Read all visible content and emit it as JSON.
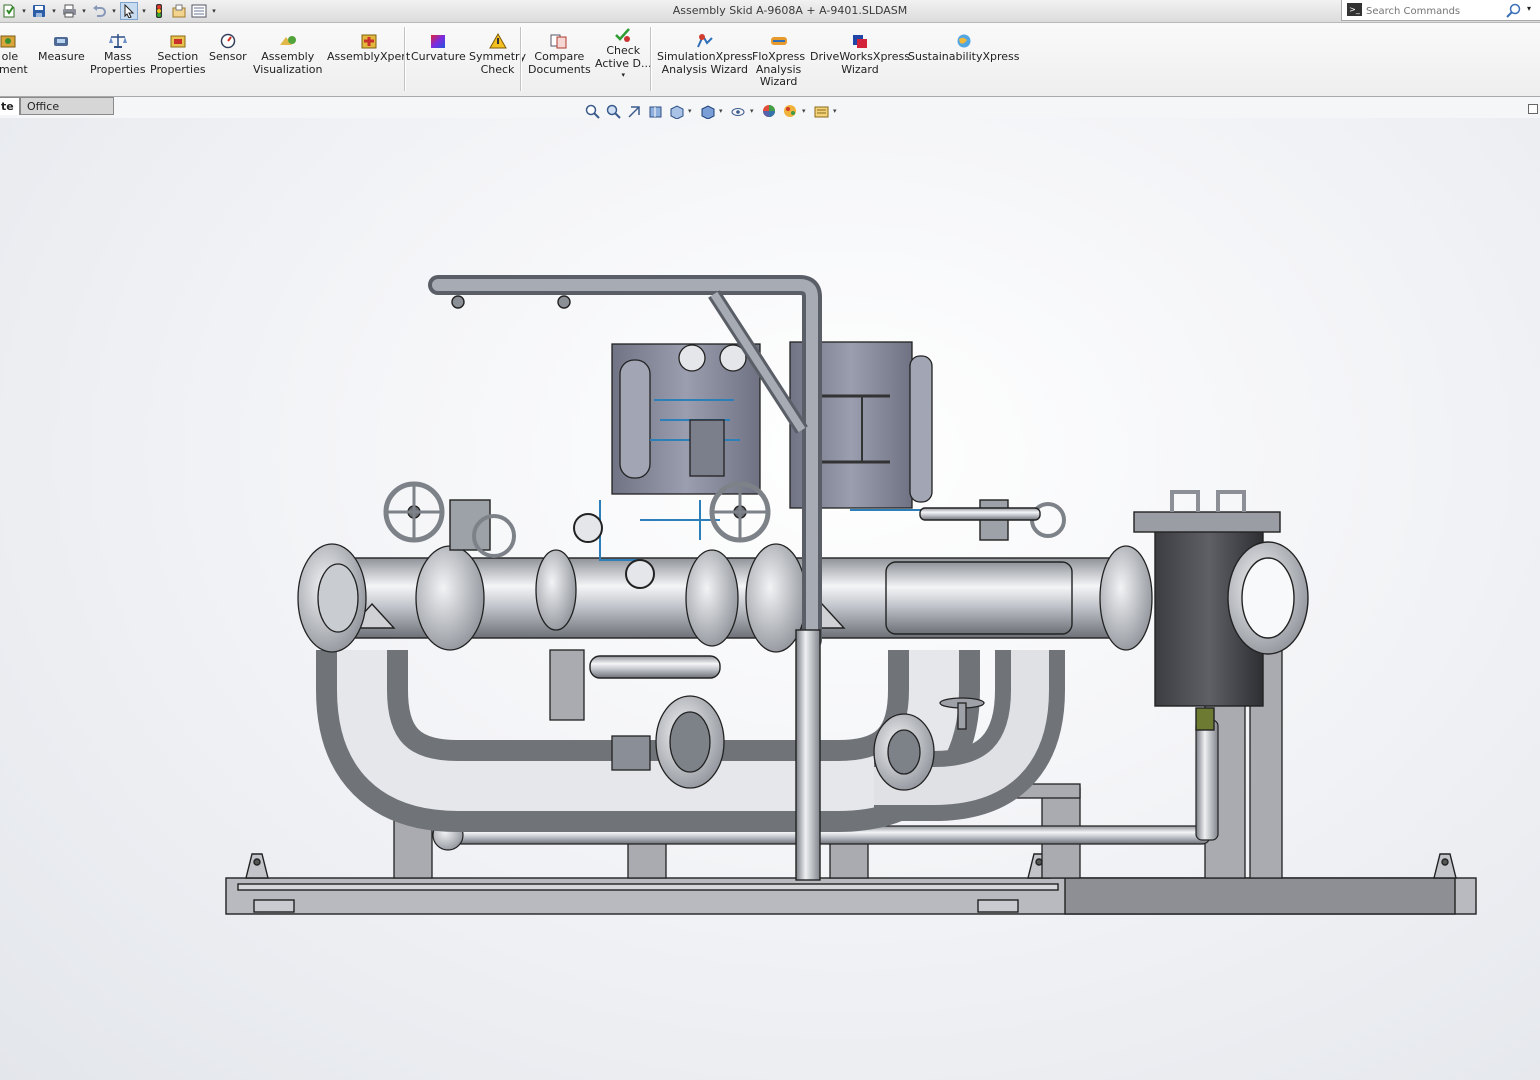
{
  "window": {
    "title": "Assembly Skid A-9608A + A-9401.SLDASM",
    "search_placeholder": "Search Commands"
  },
  "quick_access": [
    "new-icon",
    "save-icon",
    "print-icon",
    "undo-icon",
    "select-icon",
    "rebuild-icon",
    "file-properties-icon",
    "options-icon"
  ],
  "ribbon": {
    "buttons": [
      {
        "id": "hole-alignment",
        "label": "ole\nnment"
      },
      {
        "id": "measure",
        "label": "Measure"
      },
      {
        "id": "mass-properties",
        "label": "Mass\nProperties"
      },
      {
        "id": "section-properties",
        "label": "Section\nProperties"
      },
      {
        "id": "sensor",
        "label": "Sensor"
      },
      {
        "id": "assembly-visualization",
        "label": "Assembly\nVisualization"
      },
      {
        "id": "assemblyxpert",
        "label": "AssemblyXpert"
      },
      {
        "id": "curvature",
        "label": "Curvature"
      },
      {
        "id": "symmetry-check",
        "label": "Symmetry\nCheck"
      },
      {
        "id": "compare-documents",
        "label": "Compare\nDocuments"
      },
      {
        "id": "check-active-document",
        "label": "Check\nActive D..."
      },
      {
        "id": "simulationxpress",
        "label": "SimulationXpress\nAnalysis Wizard"
      },
      {
        "id": "floxpress",
        "label": "FloXpress\nAnalysis\nWizard"
      },
      {
        "id": "driveworksxpress",
        "label": "DriveWorksXpress\nWizard"
      },
      {
        "id": "sustainabilityxpress",
        "label": "SustainabilityXpress"
      }
    ]
  },
  "tabs": {
    "evaluate": "te",
    "office_products": "Office Products"
  },
  "view_toolbar": [
    "zoom-to-fit-icon",
    "zoom-to-area-icon",
    "previous-view-icon",
    "section-view-icon",
    "view-orientation-icon",
    "display-style-icon",
    "hide-show-items-icon",
    "edit-appearance-icon",
    "apply-scene-icon",
    "view-settings-icon"
  ],
  "colors": {
    "pipe": "#c9ccd2",
    "equipment": "#7e8292",
    "frame": "#a6a8ad",
    "edge": "#202020"
  }
}
